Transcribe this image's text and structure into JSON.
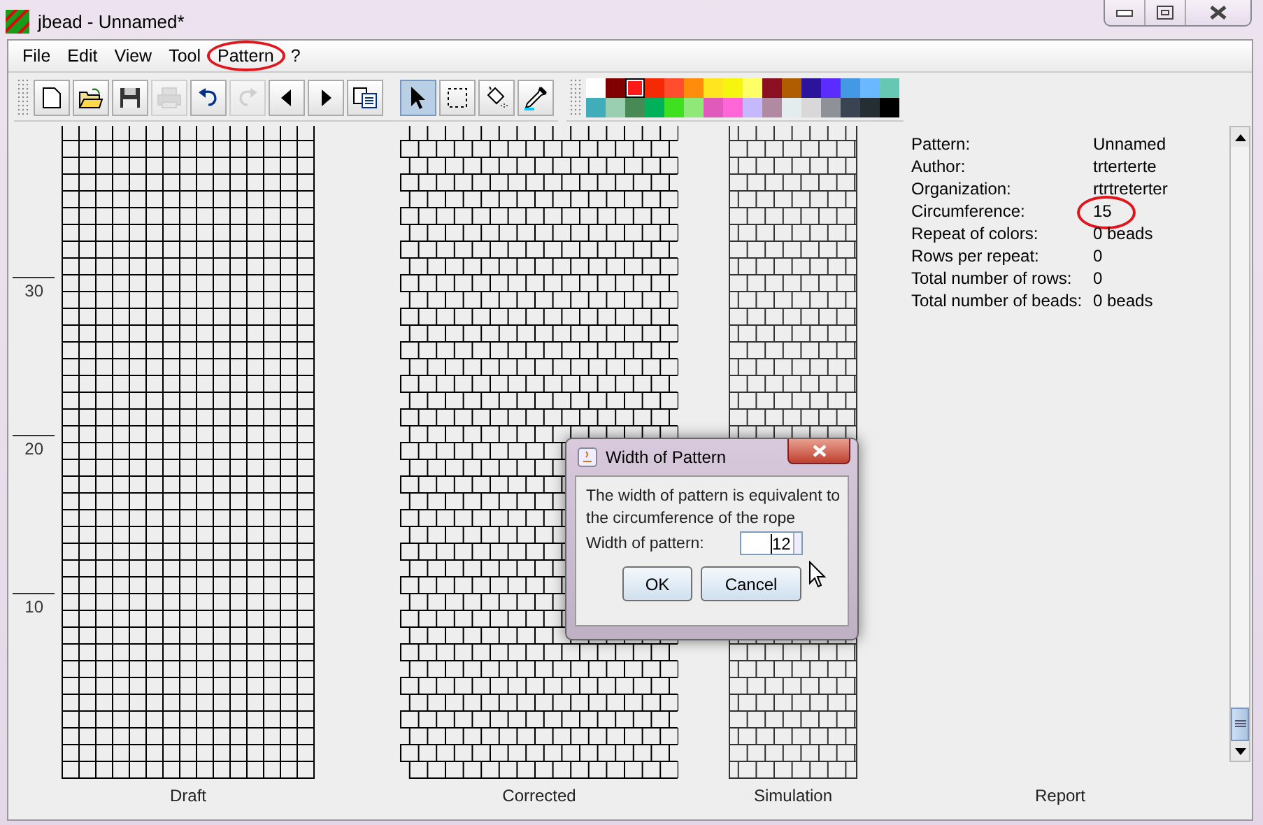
{
  "window": {
    "title": "jbead - Unnamed*"
  },
  "menu": [
    {
      "label": "File",
      "highlighted": false
    },
    {
      "label": "Edit",
      "highlighted": false
    },
    {
      "label": "View",
      "highlighted": false
    },
    {
      "label": "Tool",
      "highlighted": false
    },
    {
      "label": "Pattern",
      "highlighted": true
    },
    {
      "label": "?",
      "highlighted": false
    }
  ],
  "toolbar": [
    {
      "kind": "new",
      "disabled": false,
      "selected": false
    },
    {
      "kind": "open",
      "disabled": false,
      "selected": false
    },
    {
      "kind": "save",
      "disabled": false,
      "selected": false
    },
    {
      "kind": "print",
      "disabled": true,
      "selected": false
    },
    {
      "kind": "undo",
      "disabled": false,
      "selected": false
    },
    {
      "kind": "redo",
      "disabled": true,
      "selected": false
    },
    {
      "kind": "left",
      "disabled": false,
      "selected": false
    },
    {
      "kind": "right",
      "disabled": false,
      "selected": false
    },
    {
      "kind": "copy",
      "disabled": false,
      "selected": false
    },
    {
      "kind": "pointer",
      "disabled": false,
      "selected": true
    },
    {
      "kind": "select",
      "disabled": false,
      "selected": false
    },
    {
      "kind": "fill",
      "disabled": false,
      "selected": false
    },
    {
      "kind": "pipette",
      "disabled": false,
      "selected": false
    }
  ],
  "palette": [
    {
      "color": "#ffffff",
      "selected": false
    },
    {
      "color": "#800000",
      "selected": false
    },
    {
      "color": "#ff1a1a",
      "selected": true
    },
    {
      "color": "#f52a05",
      "selected": false
    },
    {
      "color": "#ff4d2e",
      "selected": false
    },
    {
      "color": "#ff8c0a",
      "selected": false
    },
    {
      "color": "#ffe51f",
      "selected": false
    },
    {
      "color": "#f5f50f",
      "selected": false
    },
    {
      "color": "#ffff66",
      "selected": false
    },
    {
      "color": "#8b0f21",
      "selected": false
    },
    {
      "color": "#b05c00",
      "selected": false
    },
    {
      "color": "#2b139b",
      "selected": false
    },
    {
      "color": "#5b2bff",
      "selected": false
    },
    {
      "color": "#4499e5",
      "selected": false
    },
    {
      "color": "#6ab8ff",
      "selected": false
    },
    {
      "color": "#66c8b3",
      "selected": false
    },
    {
      "color": "#41adba",
      "selected": false
    },
    {
      "color": "#99cfb0",
      "selected": false
    },
    {
      "color": "#478a55",
      "selected": false
    },
    {
      "color": "#00b05a",
      "selected": false
    },
    {
      "color": "#3fe020",
      "selected": false
    },
    {
      "color": "#8fe878",
      "selected": false
    },
    {
      "color": "#e05abb",
      "selected": false
    },
    {
      "color": "#ff66d8",
      "selected": false
    },
    {
      "color": "#c6b8ff",
      "selected": false
    },
    {
      "color": "#b08aa0",
      "selected": false
    },
    {
      "color": "#e3eded",
      "selected": false
    },
    {
      "color": "#d8d8d8",
      "selected": false
    },
    {
      "color": "#8f9199",
      "selected": false
    },
    {
      "color": "#394352",
      "selected": false
    },
    {
      "color": "#252e33",
      "selected": false
    },
    {
      "color": "#000000",
      "selected": false
    }
  ],
  "ruler": [
    "30",
    "20",
    "10"
  ],
  "views": [
    "Draft",
    "Corrected",
    "Simulation",
    "Report"
  ],
  "report": [
    {
      "label": "Pattern:",
      "value": "Unnamed",
      "highlighted": false
    },
    {
      "label": "Author:",
      "value": "trterterte",
      "highlighted": false
    },
    {
      "label": "Organization:",
      "value": "rtrtreterter",
      "highlighted": false
    },
    {
      "label": "Circumference:",
      "value": "15",
      "highlighted": true
    },
    {
      "label": "Repeat of colors:",
      "value": "0 beads",
      "highlighted": false
    },
    {
      "label": "Rows per repeat:",
      "value": "0",
      "highlighted": false
    },
    {
      "label": "Total number of rows:",
      "value": "0",
      "highlighted": false
    },
    {
      "label": "Total number of beads:",
      "value": "0 beads",
      "highlighted": false
    }
  ],
  "dialog": {
    "title": "Width of Pattern",
    "message": "The width of pattern is equivalent to the circumference of the rope",
    "field_label": "Width of pattern:",
    "value": "12",
    "buttons": [
      "OK",
      "Cancel"
    ]
  }
}
